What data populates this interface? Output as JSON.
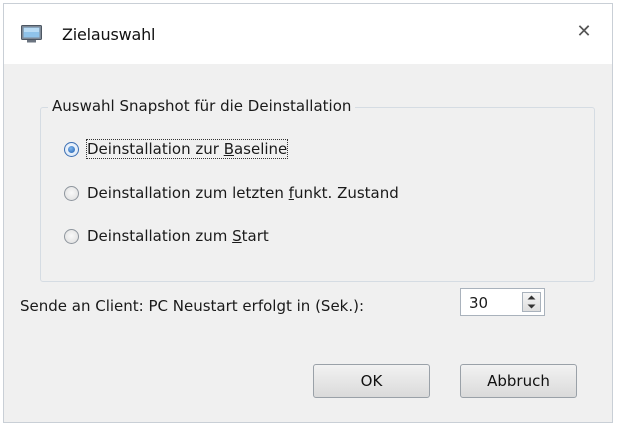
{
  "window": {
    "title": "Zielauswahl",
    "icon": "monitor-icon",
    "close_glyph": "✕"
  },
  "snapshot_group": {
    "legend": "Auswahl Snapshot für die Deinstallation",
    "options": [
      {
        "pre": "Deinstallation zur ",
        "mnemonic": "B",
        "post": "aseline",
        "checked": true
      },
      {
        "pre": "Deinstallation zum letzten ",
        "mnemonic": "f",
        "post": "unkt. Zustand",
        "checked": false
      },
      {
        "pre": "Deinstallation zum ",
        "mnemonic": "S",
        "post": "tart",
        "checked": false
      }
    ]
  },
  "timeout": {
    "label": "Sende an Client: PC Neustart erfolgt in (Sek.):",
    "value": "30"
  },
  "buttons": {
    "ok": "OK",
    "cancel": "Abbruch"
  },
  "colors": {
    "client_background": "#f0f0f0",
    "radio_checked": "#1f5fb1"
  }
}
